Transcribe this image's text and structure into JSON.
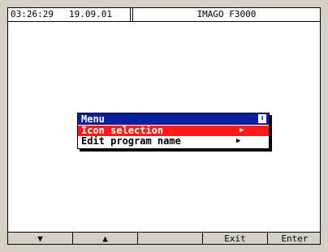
{
  "status_bar": {
    "time": "03:26:29",
    "date": "19.09.01",
    "title": "IMAGO F3000"
  },
  "menu": {
    "title": "Menu",
    "scroll_icon": "scroll-down-icon",
    "items": [
      {
        "label": "Icon selection",
        "selected": true,
        "arrow": "▶"
      },
      {
        "label": "Edit program name",
        "selected": false,
        "arrow": "▶"
      }
    ],
    "colors": {
      "title_bg": "#0b1f9c",
      "selected_bg": "#ff1a1a"
    }
  },
  "softkeys": [
    {
      "label": "▼",
      "icon": "down-arrow-icon"
    },
    {
      "label": "▲",
      "icon": "up-arrow-icon"
    },
    {
      "label": ""
    },
    {
      "label": "Exit"
    },
    {
      "label": "Enter"
    }
  ]
}
